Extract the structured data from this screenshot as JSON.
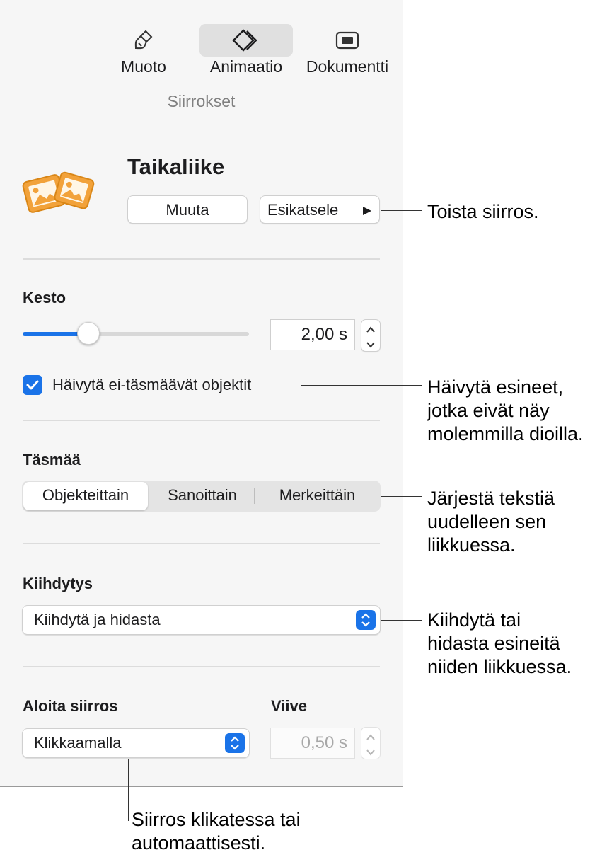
{
  "toolbar": {
    "tabs": [
      {
        "label": "Muoto",
        "icon": "paintbrush-icon"
      },
      {
        "label": "Animaatio",
        "icon": "animation-diamond-icon"
      },
      {
        "label": "Dokumentti",
        "icon": "document-rectangle-icon"
      }
    ],
    "active_tab": "Animaatio"
  },
  "section": {
    "title": "Siirrokset"
  },
  "transition": {
    "name": "Taikaliike",
    "icon": "magic-move-icon",
    "change_button": "Muuta",
    "preview_button": "Esikatsele",
    "preview_icon": "play-icon"
  },
  "duration": {
    "label": "Kesto",
    "value": "2,00 s",
    "slider_fraction": 0.29
  },
  "fade_checkbox": {
    "label": "Häivytä ei-täsmäävät objektit",
    "checked": true
  },
  "match": {
    "label": "Täsmää",
    "options": [
      "Objekteittain",
      "Sanoittain",
      "Merkeittäin"
    ],
    "selected": "Objekteittain"
  },
  "acceleration": {
    "label": "Kiihdytys",
    "value": "Kiihdytä ja hidasta"
  },
  "start": {
    "label": "Aloita siirros",
    "value": "Klikkaamalla"
  },
  "delay": {
    "label": "Viive",
    "value": "0,50 s"
  },
  "callouts": {
    "preview": "Toista siirros.",
    "fade": "Häivytä esineet,\njotka eivät näy\nmolemmilla dioilla.",
    "match": "Järjestä tekstiä\nuudelleen sen\nliikkuessa.",
    "acceleration": "Kiihdytä tai\nhidasta esineitä\nniiden liikkuessa.",
    "start": "Siirros klikatessa tai\nautomaattisesti."
  },
  "colors": {
    "accent": "#1a73e8",
    "icon_orange": "#f2a23a"
  }
}
